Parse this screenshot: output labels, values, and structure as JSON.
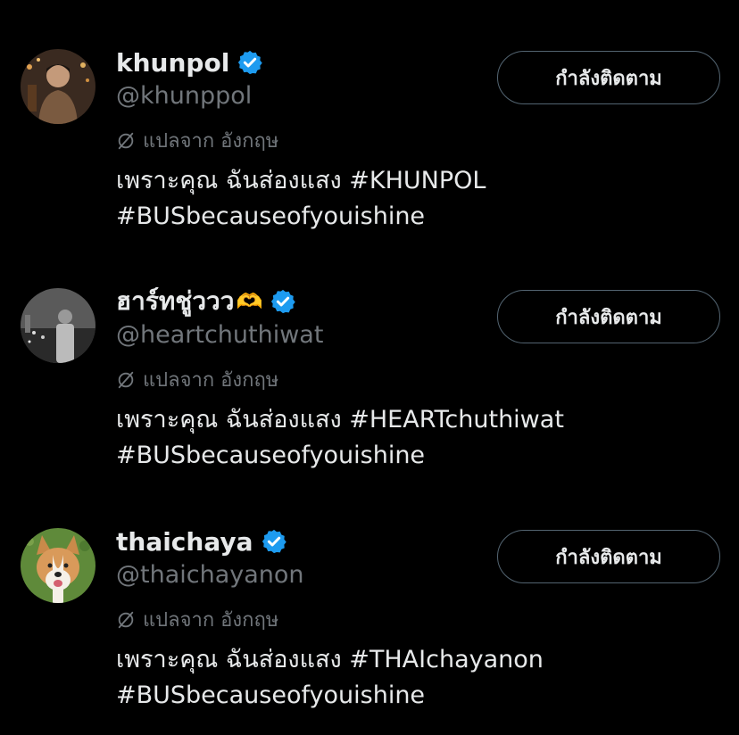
{
  "users": [
    {
      "display_name": "khunpol",
      "emoji": "",
      "handle": "@khunppol",
      "translate_label": "แปลจาก อังกฤษ",
      "bio_line1": "เพราะคุณ ฉันส่องแสง #KHUNPOL",
      "bio_line2": "#BUSbecauseofyouishine",
      "follow_label": "กำลังติดตาม"
    },
    {
      "display_name": "ฮาร์ทชู่ววว",
      "emoji": "🫶",
      "handle": "@heartchuthiwat",
      "translate_label": "แปลจาก อังกฤษ",
      "bio_line1": "เพราะคุณ ฉันส่องแสง #HEARTchuthiwat",
      "bio_line2": "#BUSbecauseofyouishine",
      "follow_label": "กำลังติดตาม"
    },
    {
      "display_name": "thaichaya",
      "emoji": "",
      "handle": "@thaichayanon",
      "translate_label": "แปลจาก อังกฤษ",
      "bio_line1": "เพราะคุณ ฉันส่องแสง #THAIchayanon",
      "bio_line2": "#BUSbecauseofyouishine",
      "follow_label": "กำลังติดตาม"
    }
  ],
  "colors": {
    "background": "#000000",
    "text_primary": "#e7e9ea",
    "text_secondary": "#71767b",
    "verified": "#1d9bf0",
    "button_border": "#536471"
  },
  "icons": {
    "verified": "verified-badge-icon",
    "translate": "translate-icon"
  }
}
